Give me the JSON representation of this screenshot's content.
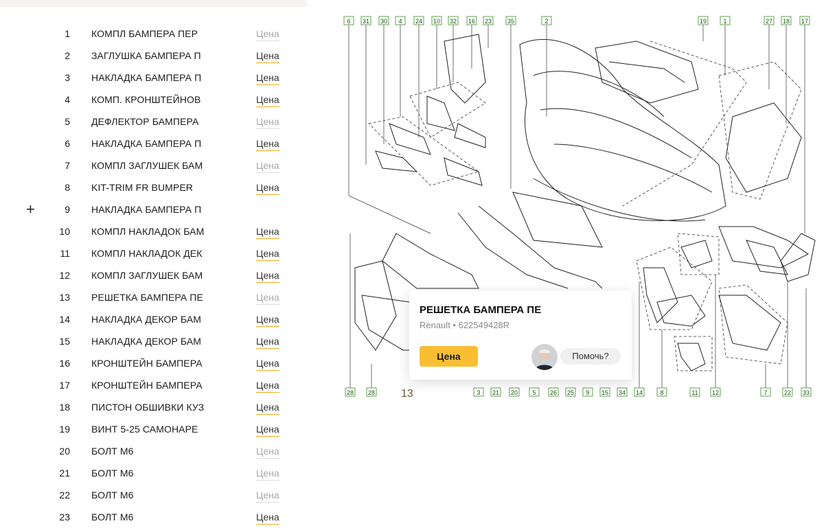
{
  "parts": [
    {
      "num": "1",
      "name": "КОМПЛ БАМПЕРА ПЕР",
      "price": "Цена",
      "active": false
    },
    {
      "num": "2",
      "name": "ЗАГЛУШКА БАМПЕРА П",
      "price": "Цена",
      "active": true
    },
    {
      "num": "3",
      "name": "НАКЛАДКА БАМПЕРА П",
      "price": "Цена",
      "active": true
    },
    {
      "num": "4",
      "name": "КОМП. КРОНШТЕЙНОВ",
      "price": "Цена",
      "active": true
    },
    {
      "num": "5",
      "name": "ДЕФЛЕКТОР БАМПЕРА",
      "price": "Цена",
      "active": false
    },
    {
      "num": "6",
      "name": "НАКЛАДКА БАМПЕРА П",
      "price": "Цена",
      "active": true
    },
    {
      "num": "7",
      "name": "КОМПЛ ЗАГЛУШЕК БАМ",
      "price": "Цена",
      "active": false
    },
    {
      "num": "8",
      "name": "KIT-TRIM FR BUMPER",
      "price": "Цена",
      "active": true
    },
    {
      "num": "9",
      "name": "НАКЛАДКА БАМПЕРА П",
      "price": "",
      "active": false,
      "plus": "+"
    },
    {
      "num": "10",
      "name": "КОМПЛ НАКЛАДОК БАМ",
      "price": "Цена",
      "active": true
    },
    {
      "num": "11",
      "name": "КОМПЛ НАКЛАДОК ДЕК",
      "price": "Цена",
      "active": true
    },
    {
      "num": "12",
      "name": "КОМПЛ ЗАГЛУШЕК БАМ",
      "price": "Цена",
      "active": true
    },
    {
      "num": "13",
      "name": "РЕШЕТКА БАМПЕРА ПЕ",
      "price": "Цена",
      "active": false
    },
    {
      "num": "14",
      "name": "НАКЛАДКА ДЕКОР БАМ",
      "price": "Цена",
      "active": true
    },
    {
      "num": "15",
      "name": "НАКЛАДКА ДЕКОР БАМ",
      "price": "Цена",
      "active": true
    },
    {
      "num": "16",
      "name": "КРОНШТЕЙН БАМПЕРА",
      "price": "Цена",
      "active": true
    },
    {
      "num": "17",
      "name": "КРОНШТЕЙН БАМПЕРА",
      "price": "Цена",
      "active": true
    },
    {
      "num": "18",
      "name": "ПИСТОН ОБШИВКИ КУЗ",
      "price": "Цена",
      "active": true
    },
    {
      "num": "19",
      "name": "ВИНТ 5-25 САМОНАРЕ",
      "price": "Цена",
      "active": true
    },
    {
      "num": "20",
      "name": "БОЛТ М6",
      "price": "Цена",
      "active": false
    },
    {
      "num": "21",
      "name": "БОЛТ М6",
      "price": "Цена",
      "active": false
    },
    {
      "num": "22",
      "name": "БОЛТ М6",
      "price": "Цена",
      "active": false
    },
    {
      "num": "23",
      "name": "БОЛТ М6",
      "price": "Цена",
      "active": true
    }
  ],
  "diagram": {
    "top_labels": [
      "6",
      "31",
      "30",
      "4",
      "24",
      "10",
      "32",
      "16",
      "23",
      "35",
      "2",
      "19",
      "1",
      "27",
      "18",
      "17"
    ],
    "bottom_labels": [
      "28",
      "28",
      "3",
      "21",
      "20",
      "5",
      "26",
      "25",
      "9",
      "15",
      "34",
      "14",
      "8",
      "11",
      "12",
      "7",
      "22",
      "33"
    ],
    "pin_label": "13"
  },
  "popup": {
    "title": "РЕШЕТКА БАМПЕРА ПЕ",
    "subtitle": "Renault • 622549428R",
    "button": "Цена",
    "help": "Помочь?"
  },
  "colors": {
    "accent": "#f9be32",
    "link_underline": "#f2a91a",
    "label_green": "#5aa64a"
  }
}
